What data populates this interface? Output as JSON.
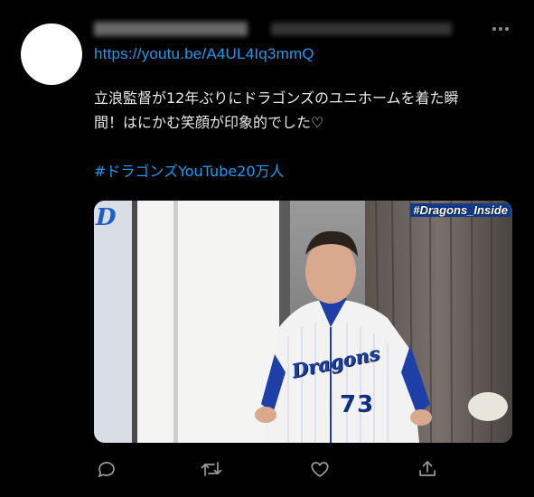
{
  "tweet": {
    "author_name": "████████████",
    "author_handle": "@████████████ · ██",
    "link_text": "https://youtu.be/A4UL4Iq3mmQ",
    "body": "立浪監督が12年ぶりにドラゴンズのユニホームを着た瞬\n間！はにかむ笑顔が印象的でした♡",
    "hashtag": "#ドラゴンズYouTube20万人",
    "media": {
      "overlay_tag": "#Dragons_Inside",
      "jersey_word": "Dragons",
      "jersey_number": "73",
      "cap_logo": "D"
    },
    "actions": [
      "reply-icon",
      "retweet-icon",
      "like-icon",
      "share-icon"
    ]
  },
  "colors": {
    "background": "#000000",
    "link": "#1d9bf0",
    "text": "#e7e9ea",
    "icon": "#9a9a9a"
  }
}
